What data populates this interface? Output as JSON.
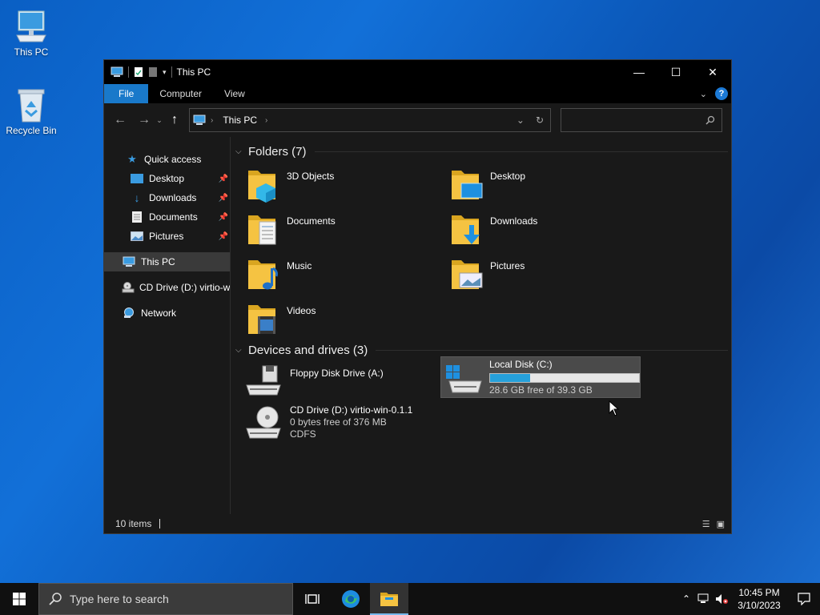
{
  "desktop": {
    "icons": [
      {
        "label": "This PC"
      },
      {
        "label": "Recycle Bin"
      }
    ]
  },
  "window": {
    "title": "This PC",
    "controls": {
      "minimize": "—",
      "maximize": "☐",
      "close": "✕"
    },
    "ribbon": {
      "tabs": [
        "File",
        "Computer",
        "View"
      ],
      "help": "?"
    },
    "address": {
      "crumb": "This PC"
    },
    "search": {
      "placeholder": ""
    },
    "nav": {
      "quick_access": "Quick access",
      "pinned": [
        {
          "label": "Desktop"
        },
        {
          "label": "Downloads"
        },
        {
          "label": "Documents"
        },
        {
          "label": "Pictures"
        }
      ],
      "this_pc": "This PC",
      "cd_drive": "CD Drive (D:) virtio-w",
      "network": "Network"
    },
    "folders_header": "Folders (7)",
    "folders": [
      {
        "label": "3D Objects"
      },
      {
        "label": "Desktop"
      },
      {
        "label": "Documents"
      },
      {
        "label": "Downloads"
      },
      {
        "label": "Music"
      },
      {
        "label": "Pictures"
      },
      {
        "label": "Videos"
      }
    ],
    "drives_header": "Devices and drives (3)",
    "drives": {
      "floppy": {
        "label": "Floppy Disk Drive (A:)"
      },
      "local": {
        "label": "Local Disk (C:)",
        "free": "28.6 GB free of 39.3 GB",
        "used_fraction": 0.27
      },
      "cd": {
        "label": "CD Drive (D:) virtio-win-0.1.1",
        "free": "0 bytes free of 376 MB",
        "fs": "CDFS"
      }
    },
    "status": {
      "items": "10 items"
    }
  },
  "taskbar": {
    "search_placeholder": "Type here to search",
    "time": "10:45 PM",
    "date": "3/10/2023"
  },
  "colors": {
    "accent": "#1979ca",
    "bar_fill": "#26a0da",
    "folder": "#f5c342"
  }
}
